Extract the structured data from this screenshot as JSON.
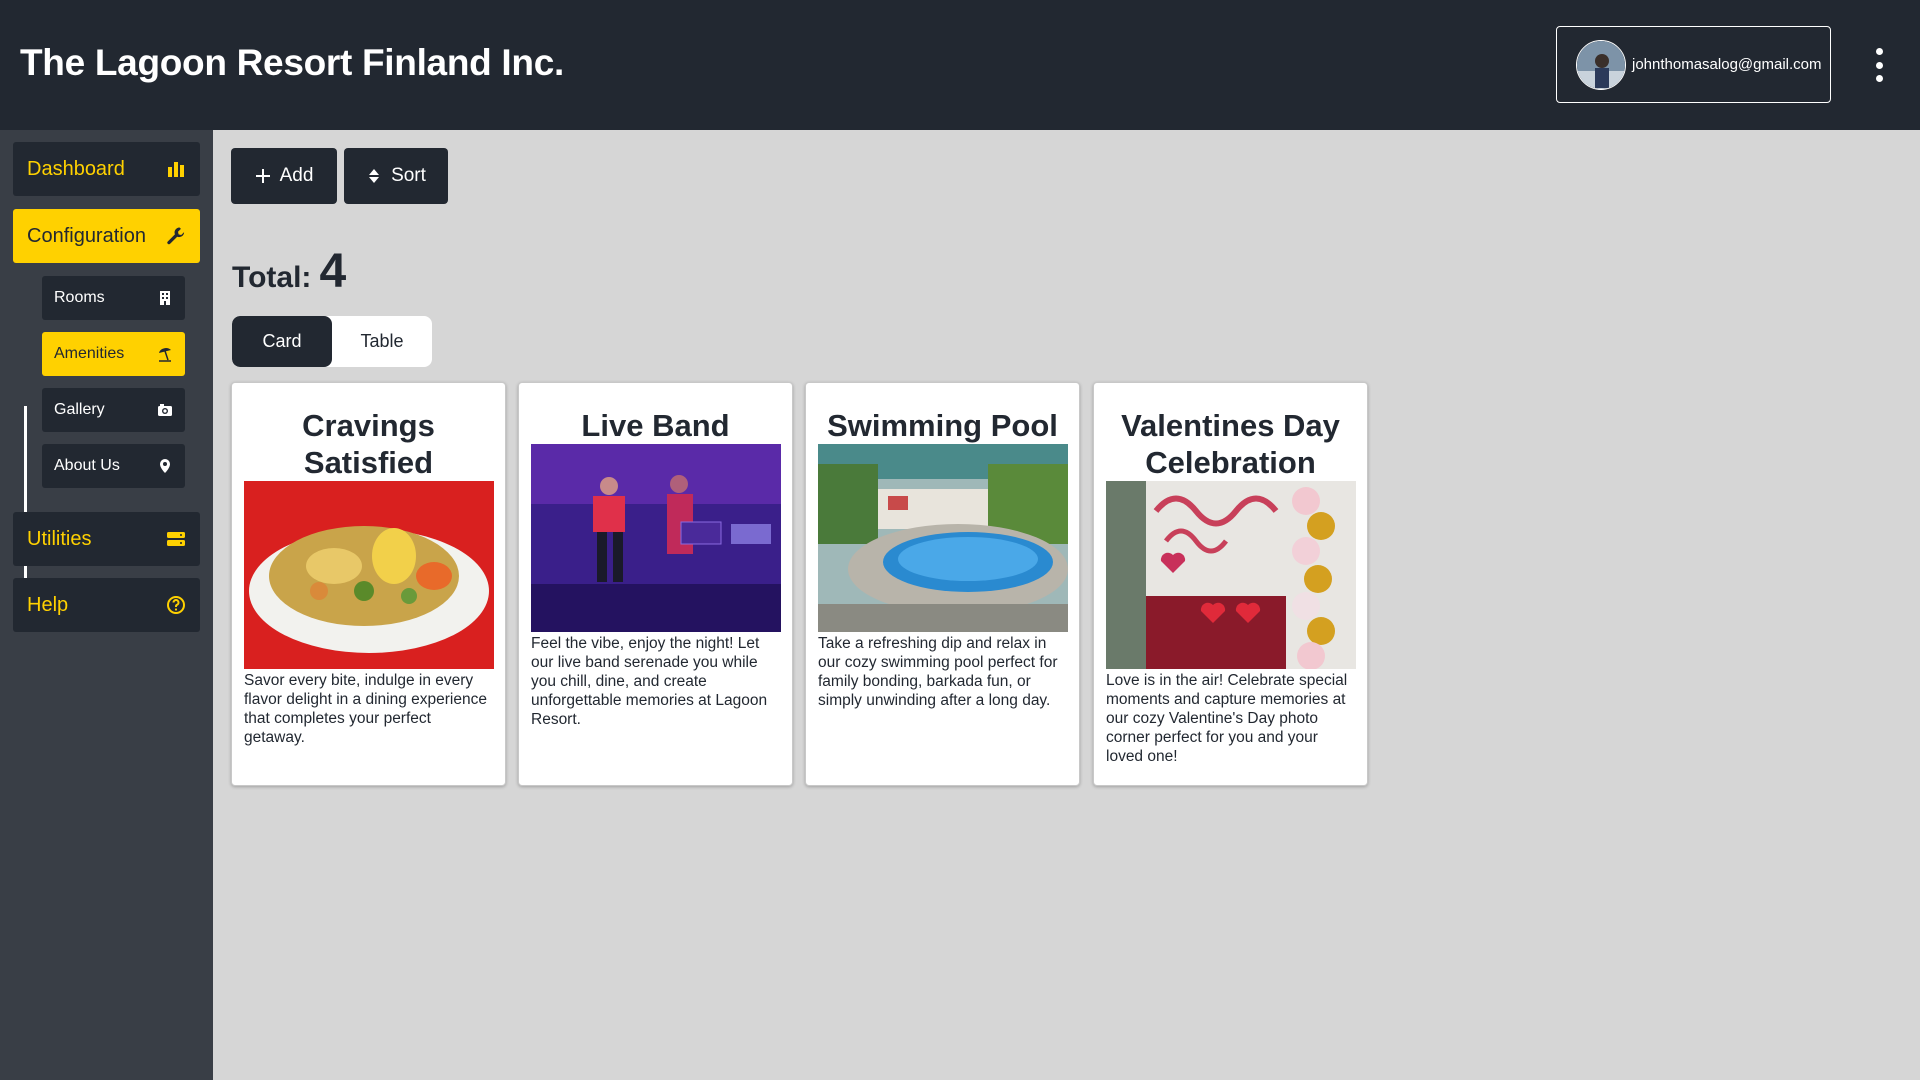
{
  "header": {
    "title": "The Lagoon Resort Finland Inc.",
    "account_email": "johnthomasalog@gmail.com"
  },
  "sidebar": {
    "items": [
      {
        "label": "Dashboard",
        "icon": "bar-chart-icon"
      },
      {
        "label": "Configuration",
        "icon": "wrench-icon",
        "active": true
      },
      {
        "label": "Utilities",
        "icon": "server-icon"
      },
      {
        "label": "Help",
        "icon": "question-circle-icon"
      }
    ],
    "sub_items": [
      {
        "label": "Rooms",
        "icon": "building-icon"
      },
      {
        "label": "Amenities",
        "icon": "beach-umbrella-icon",
        "active": true
      },
      {
        "label": "Gallery",
        "icon": "camera-icon"
      },
      {
        "label": "About Us",
        "icon": "map-pin-icon"
      }
    ]
  },
  "toolbar": {
    "add_label": "Add",
    "sort_label": "Sort"
  },
  "summary": {
    "total_label": "Total:",
    "total_value": "4"
  },
  "view_toggle": {
    "card_label": "Card",
    "table_label": "Table",
    "selected": "Card"
  },
  "cards": [
    {
      "title": "Cravings Satisfied",
      "description": "Savor every bite, indulge in every flavor delight in a dining experience that completes your perfect getaway."
    },
    {
      "title": "Live Band",
      "description": "Feel the vibe, enjoy the night! Let our live band serenade you while you chill, dine, and create unforgettable memories at Lagoon Resort."
    },
    {
      "title": "Swimming Pool",
      "description": "Take a refreshing dip and relax in our cozy swimming pool perfect for family bonding, barkada fun, or simply unwinding after a long day."
    },
    {
      "title": "Valentines Day Celebration",
      "description": "Love is in the air! Celebrate special moments and capture memories at our cozy Valentine's Day photo corner perfect for you and your loved one!"
    }
  ],
  "colors": {
    "header_bg": "#222831",
    "sidebar_bg": "#393e46",
    "accent": "#ffd100",
    "content_bg": "#d6d6d6"
  }
}
